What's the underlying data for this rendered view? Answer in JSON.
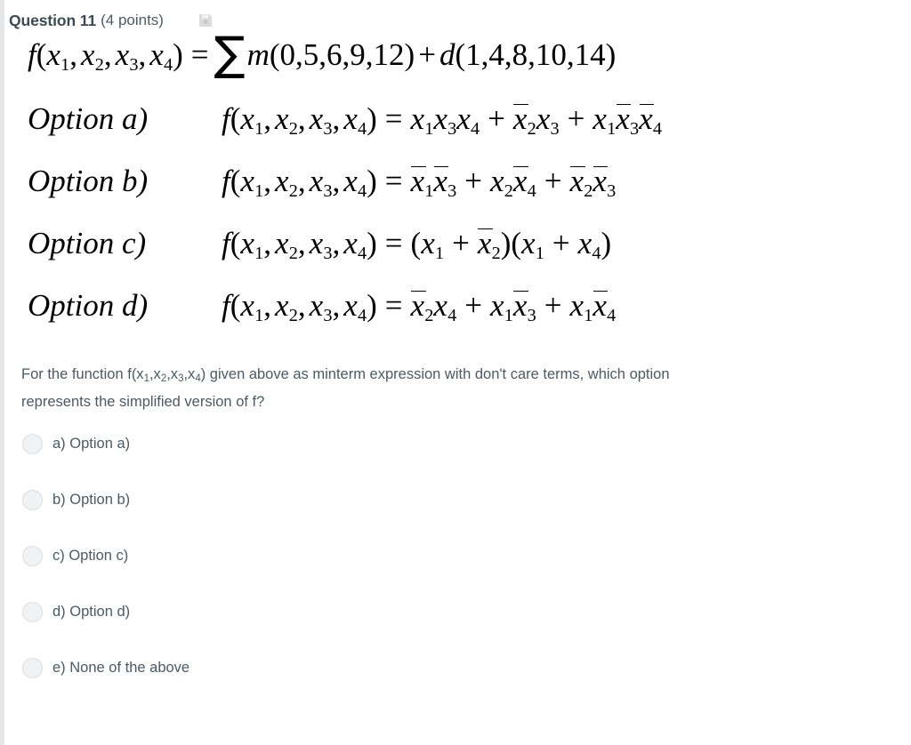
{
  "header": {
    "question_title": "Question 11",
    "points": "(4 points)",
    "flag_icon": "save-file-icon"
  },
  "math": {
    "definition": {
      "lhs": "f(x1, x2, x3, x4) =",
      "sum_symbol": "∑",
      "minterms": "m(0,5,6,9,12)",
      "plus": "+",
      "dontcares": "d(1,4,8,10,14)",
      "plain": "f(x1,x2,x3,x4) = ∑ m(0,5,6,9,12) + d(1,4,8,10,14)"
    },
    "options": [
      {
        "label": "Option a)",
        "expression_plain": "f(x1,x2,x3,x4) = x1x3x4 + x̅2x3 + x1x̅3x̅4"
      },
      {
        "label": "Option b)",
        "expression_plain": "f(x1,x2,x3,x4) = x̅1x̅3 + x2x̅4 + x̅2x̅3"
      },
      {
        "label": "Option c)",
        "expression_plain": "f(x1,x2,x3,x4) = (x1 + x̅2)(x1 + x4)"
      },
      {
        "label": "Option d)",
        "expression_plain": "f(x1,x2,x3,x4) = x̅2x4 + x1x̅3 + x1x̅4"
      }
    ]
  },
  "prompt": {
    "line1_a": "For the function f(x",
    "line1_sub1": "1",
    "line1_b": ",x",
    "line1_sub2": "2",
    "line1_c": ",x",
    "line1_sub3": "3",
    "line1_d": ",x",
    "line1_sub4": "4",
    "line1_e": ") given above as minterm expression with don't care terms, which option represents the simplified version of f?",
    "full_text": "For the function f(x1,x2,x3,x4) given above as minterm expression with don't care terms, which option represents the simplified version of f?"
  },
  "choices": [
    {
      "id": "a",
      "label": "a) Option a)",
      "selected": false
    },
    {
      "id": "b",
      "label": "b) Option b)",
      "selected": false
    },
    {
      "id": "c",
      "label": "c) Option c)",
      "selected": false
    },
    {
      "id": "d",
      "label": "d) Option d)",
      "selected": false
    },
    {
      "id": "e",
      "label": "e) None of the above",
      "selected": false
    }
  ],
  "colors": {
    "text": "#4b5a65",
    "heading": "#3c4a55",
    "math": "#000000",
    "radio_fill": "#f1f2f4",
    "radio_border": "#dcdee2",
    "edge_strip": "#e4e6e9",
    "background": "#ffffff"
  }
}
